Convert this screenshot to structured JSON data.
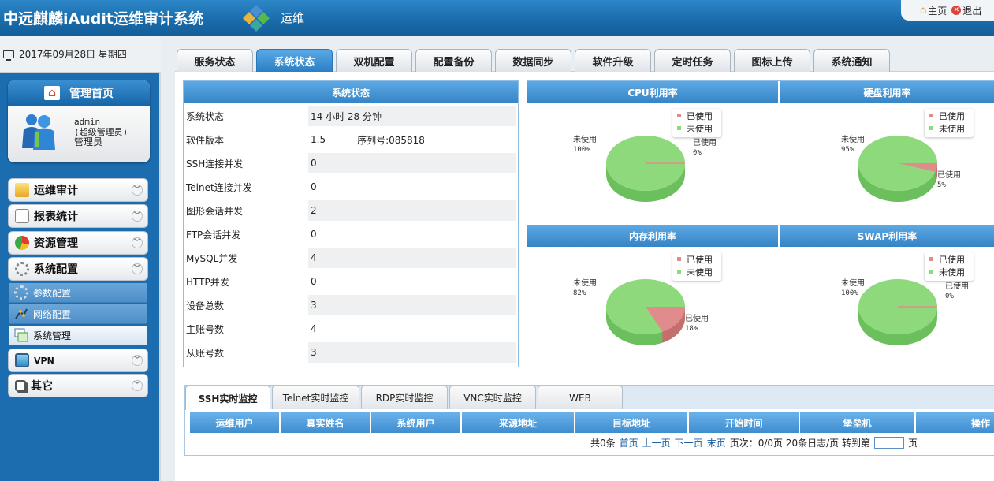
{
  "header": {
    "app_title": "中远麒麟iAudit运维审计系统",
    "module": "运维",
    "home_link": "主页",
    "logout_link": "退出"
  },
  "sidebar": {
    "date": "2017年09月28日 星期四",
    "admin_card": {
      "title": "管理首页",
      "user": "admin",
      "role_detail": "(超级管理员)",
      "role": "管理员"
    },
    "menu": [
      {
        "label": "运维审计",
        "icon": "folder-icon"
      },
      {
        "label": "报表统计",
        "icon": "report-icon"
      },
      {
        "label": "资源管理",
        "icon": "resource-icon"
      },
      {
        "label": "系统配置",
        "icon": "gear-icon"
      }
    ],
    "submenu": [
      {
        "label": "参数配置",
        "icon": "settings-icon"
      },
      {
        "label": "网络配置",
        "icon": "network-icon"
      },
      {
        "label": "系统管理",
        "icon": "window-icon"
      }
    ],
    "menu_after": [
      {
        "label": "VPN",
        "icon": "vpn-icon"
      },
      {
        "label": "其它",
        "icon": "copy-icon"
      }
    ]
  },
  "tabs": {
    "items": [
      "服务状态",
      "系统状态",
      "双机配置",
      "配置备份",
      "数据同步",
      "软件升级",
      "定时任务",
      "图标上传",
      "系统通知"
    ],
    "active": "系统状态"
  },
  "system_status": {
    "title": "系统状态",
    "rows": [
      {
        "key": "系统状态",
        "value": "14 小时 28 分钟"
      },
      {
        "key": "软件版本",
        "value": "1.5",
        "extra": "序列号:085818"
      },
      {
        "key": "SSH连接并发",
        "value": "0"
      },
      {
        "key": "Telnet连接并发",
        "value": "0"
      },
      {
        "key": "图形会话并发",
        "value": "2"
      },
      {
        "key": "FTP会话并发",
        "value": "0"
      },
      {
        "key": "MySQL并发",
        "value": "4"
      },
      {
        "key": "HTTP并发",
        "value": "0"
      },
      {
        "key": "设备总数",
        "value": "3"
      },
      {
        "key": "主账号数",
        "value": "4"
      },
      {
        "key": "从账号数",
        "value": "3"
      }
    ]
  },
  "legend": {
    "used": "已使用",
    "unused": "未使用"
  },
  "colors": {
    "used": "#e08c8c",
    "unused": "#8ed97c",
    "used_dark": "#c66e6e",
    "unused_dark": "#6cbf5d"
  },
  "chart_data": [
    {
      "type": "pie",
      "title": "CPU利用率",
      "categories": [
        "已使用",
        "未使用"
      ],
      "values": [
        0,
        100
      ],
      "labels": [
        "0%",
        "100%"
      ]
    },
    {
      "type": "pie",
      "title": "硬盘利用率",
      "categories": [
        "已使用",
        "未使用"
      ],
      "values": [
        5,
        95
      ],
      "labels": [
        "5%",
        "95%"
      ]
    },
    {
      "type": "pie",
      "title": "内存利用率",
      "categories": [
        "已使用",
        "未使用"
      ],
      "values": [
        18,
        82
      ],
      "labels": [
        "18%",
        "82%"
      ]
    },
    {
      "type": "pie",
      "title": "SWAP利用率",
      "categories": [
        "已使用",
        "未使用"
      ],
      "values": [
        0,
        100
      ],
      "labels": [
        "0%",
        "100%"
      ]
    }
  ],
  "monitor": {
    "tabs": [
      "SSH实时监控",
      "Telnet实时监控",
      "RDP实时监控",
      "VNC实时监控",
      "WEB"
    ],
    "active": "SSH实时监控",
    "columns": [
      "运维用户",
      "真实姓名",
      "系统用户",
      "来源地址",
      "目标地址",
      "开始时间",
      "堡垒机",
      "操作"
    ],
    "pager": {
      "total": "共0条",
      "first": "首页",
      "prev": "上一页",
      "next": "下一页",
      "last": "末页",
      "page_info": "页次：0/0页 20条日志/页 转到第",
      "page_suffix": "页",
      "jump_value": ""
    }
  }
}
